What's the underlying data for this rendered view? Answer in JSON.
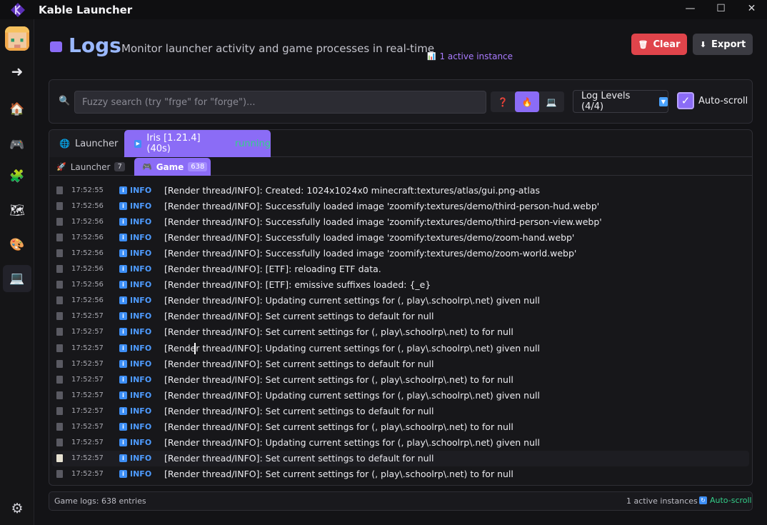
{
  "window": {
    "title": "Kable Launcher"
  },
  "header": {
    "title": "Logs",
    "subtitle": "Monitor launcher activity and game processes in real-time",
    "active_instance": "1 active instance",
    "clear_label": "Clear",
    "export_label": "Export"
  },
  "toolbar": {
    "search_placeholder": "Fuzzy search (try \"frge\" for \"forge\")...",
    "log_levels_label": "Log Levels (4/4)",
    "autoscroll_label": "Auto-scroll"
  },
  "tabs": {
    "primary": [
      {
        "label": "Launcher"
      },
      {
        "label": "Iris [1.21.4] (40s)",
        "status": "running"
      }
    ],
    "secondary": [
      {
        "label": "Launcher",
        "count": "7"
      },
      {
        "label": "Game",
        "count": "638"
      }
    ]
  },
  "logs": [
    {
      "time": "17:52:55",
      "level": "INFO",
      "message": "[Render thread/INFO]: Created: 1024x1024x0 minecraft:textures/atlas/gui.png-atlas"
    },
    {
      "time": "17:52:56",
      "level": "INFO",
      "message": "[Render thread/INFO]: Successfully loaded image 'zoomify:textures/demo/third-person-hud.webp'"
    },
    {
      "time": "17:52:56",
      "level": "INFO",
      "message": "[Render thread/INFO]: Successfully loaded image 'zoomify:textures/demo/third-person-view.webp'"
    },
    {
      "time": "17:52:56",
      "level": "INFO",
      "message": "[Render thread/INFO]: Successfully loaded image 'zoomify:textures/demo/zoom-hand.webp'"
    },
    {
      "time": "17:52:56",
      "level": "INFO",
      "message": "[Render thread/INFO]: Successfully loaded image 'zoomify:textures/demo/zoom-world.webp'"
    },
    {
      "time": "17:52:56",
      "level": "INFO",
      "message": "[Render thread/INFO]: [ETF]: reloading ETF data."
    },
    {
      "time": "17:52:56",
      "level": "INFO",
      "message": "[Render thread/INFO]: [ETF]: emissive suffixes loaded: {_e}"
    },
    {
      "time": "17:52:56",
      "level": "INFO",
      "message": "[Render thread/INFO]: Updating current settings for (, play\\.schoolrp\\.net) given null"
    },
    {
      "time": "17:52:57",
      "level": "INFO",
      "message": "[Render thread/INFO]: Set current settings to default  for null"
    },
    {
      "time": "17:52:57",
      "level": "INFO",
      "message": "[Render thread/INFO]: Set current settings for (, play\\.schoolrp\\.net) to  for null"
    },
    {
      "time": "17:52:57",
      "level": "INFO",
      "message": "[Render thread/INFO]: Updating current settings for (, play\\.schoolrp\\.net) given null"
    },
    {
      "time": "17:52:57",
      "level": "INFO",
      "message": "[Render thread/INFO]: Set current settings to default  for null"
    },
    {
      "time": "17:52:57",
      "level": "INFO",
      "message": "[Render thread/INFO]: Set current settings for (, play\\.schoolrp\\.net) to  for null"
    },
    {
      "time": "17:52:57",
      "level": "INFO",
      "message": "[Render thread/INFO]: Updating current settings for (, play\\.schoolrp\\.net) given null"
    },
    {
      "time": "17:52:57",
      "level": "INFO",
      "message": "[Render thread/INFO]: Set current settings to default  for null"
    },
    {
      "time": "17:52:57",
      "level": "INFO",
      "message": "[Render thread/INFO]: Set current settings for (, play\\.schoolrp\\.net) to  for null"
    },
    {
      "time": "17:52:57",
      "level": "INFO",
      "message": "[Render thread/INFO]: Updating current settings for (, play\\.schoolrp\\.net) given null"
    },
    {
      "time": "17:52:57",
      "level": "INFO",
      "message": "[Render thread/INFO]: Set current settings to default  for null"
    },
    {
      "time": "17:52:57",
      "level": "INFO",
      "message": "[Render thread/INFO]: Set current settings for (, play\\.schoolrp\\.net) to  for null"
    }
  ],
  "status": {
    "left": "Game logs: 638 entries",
    "instances": "1 active instances",
    "autoscroll": "Auto-scroll"
  },
  "icons": {
    "sidebar": [
      "arrow-right-icon",
      "home-icon",
      "gamepad-icon",
      "puzzle-icon",
      "map-icon",
      "palette-icon",
      "laptop-icon",
      "gear-icon"
    ]
  },
  "colors": {
    "accent": "#8b6cf6",
    "danger": "#e0444b",
    "info": "#4e9bff",
    "running": "#34d08a"
  }
}
